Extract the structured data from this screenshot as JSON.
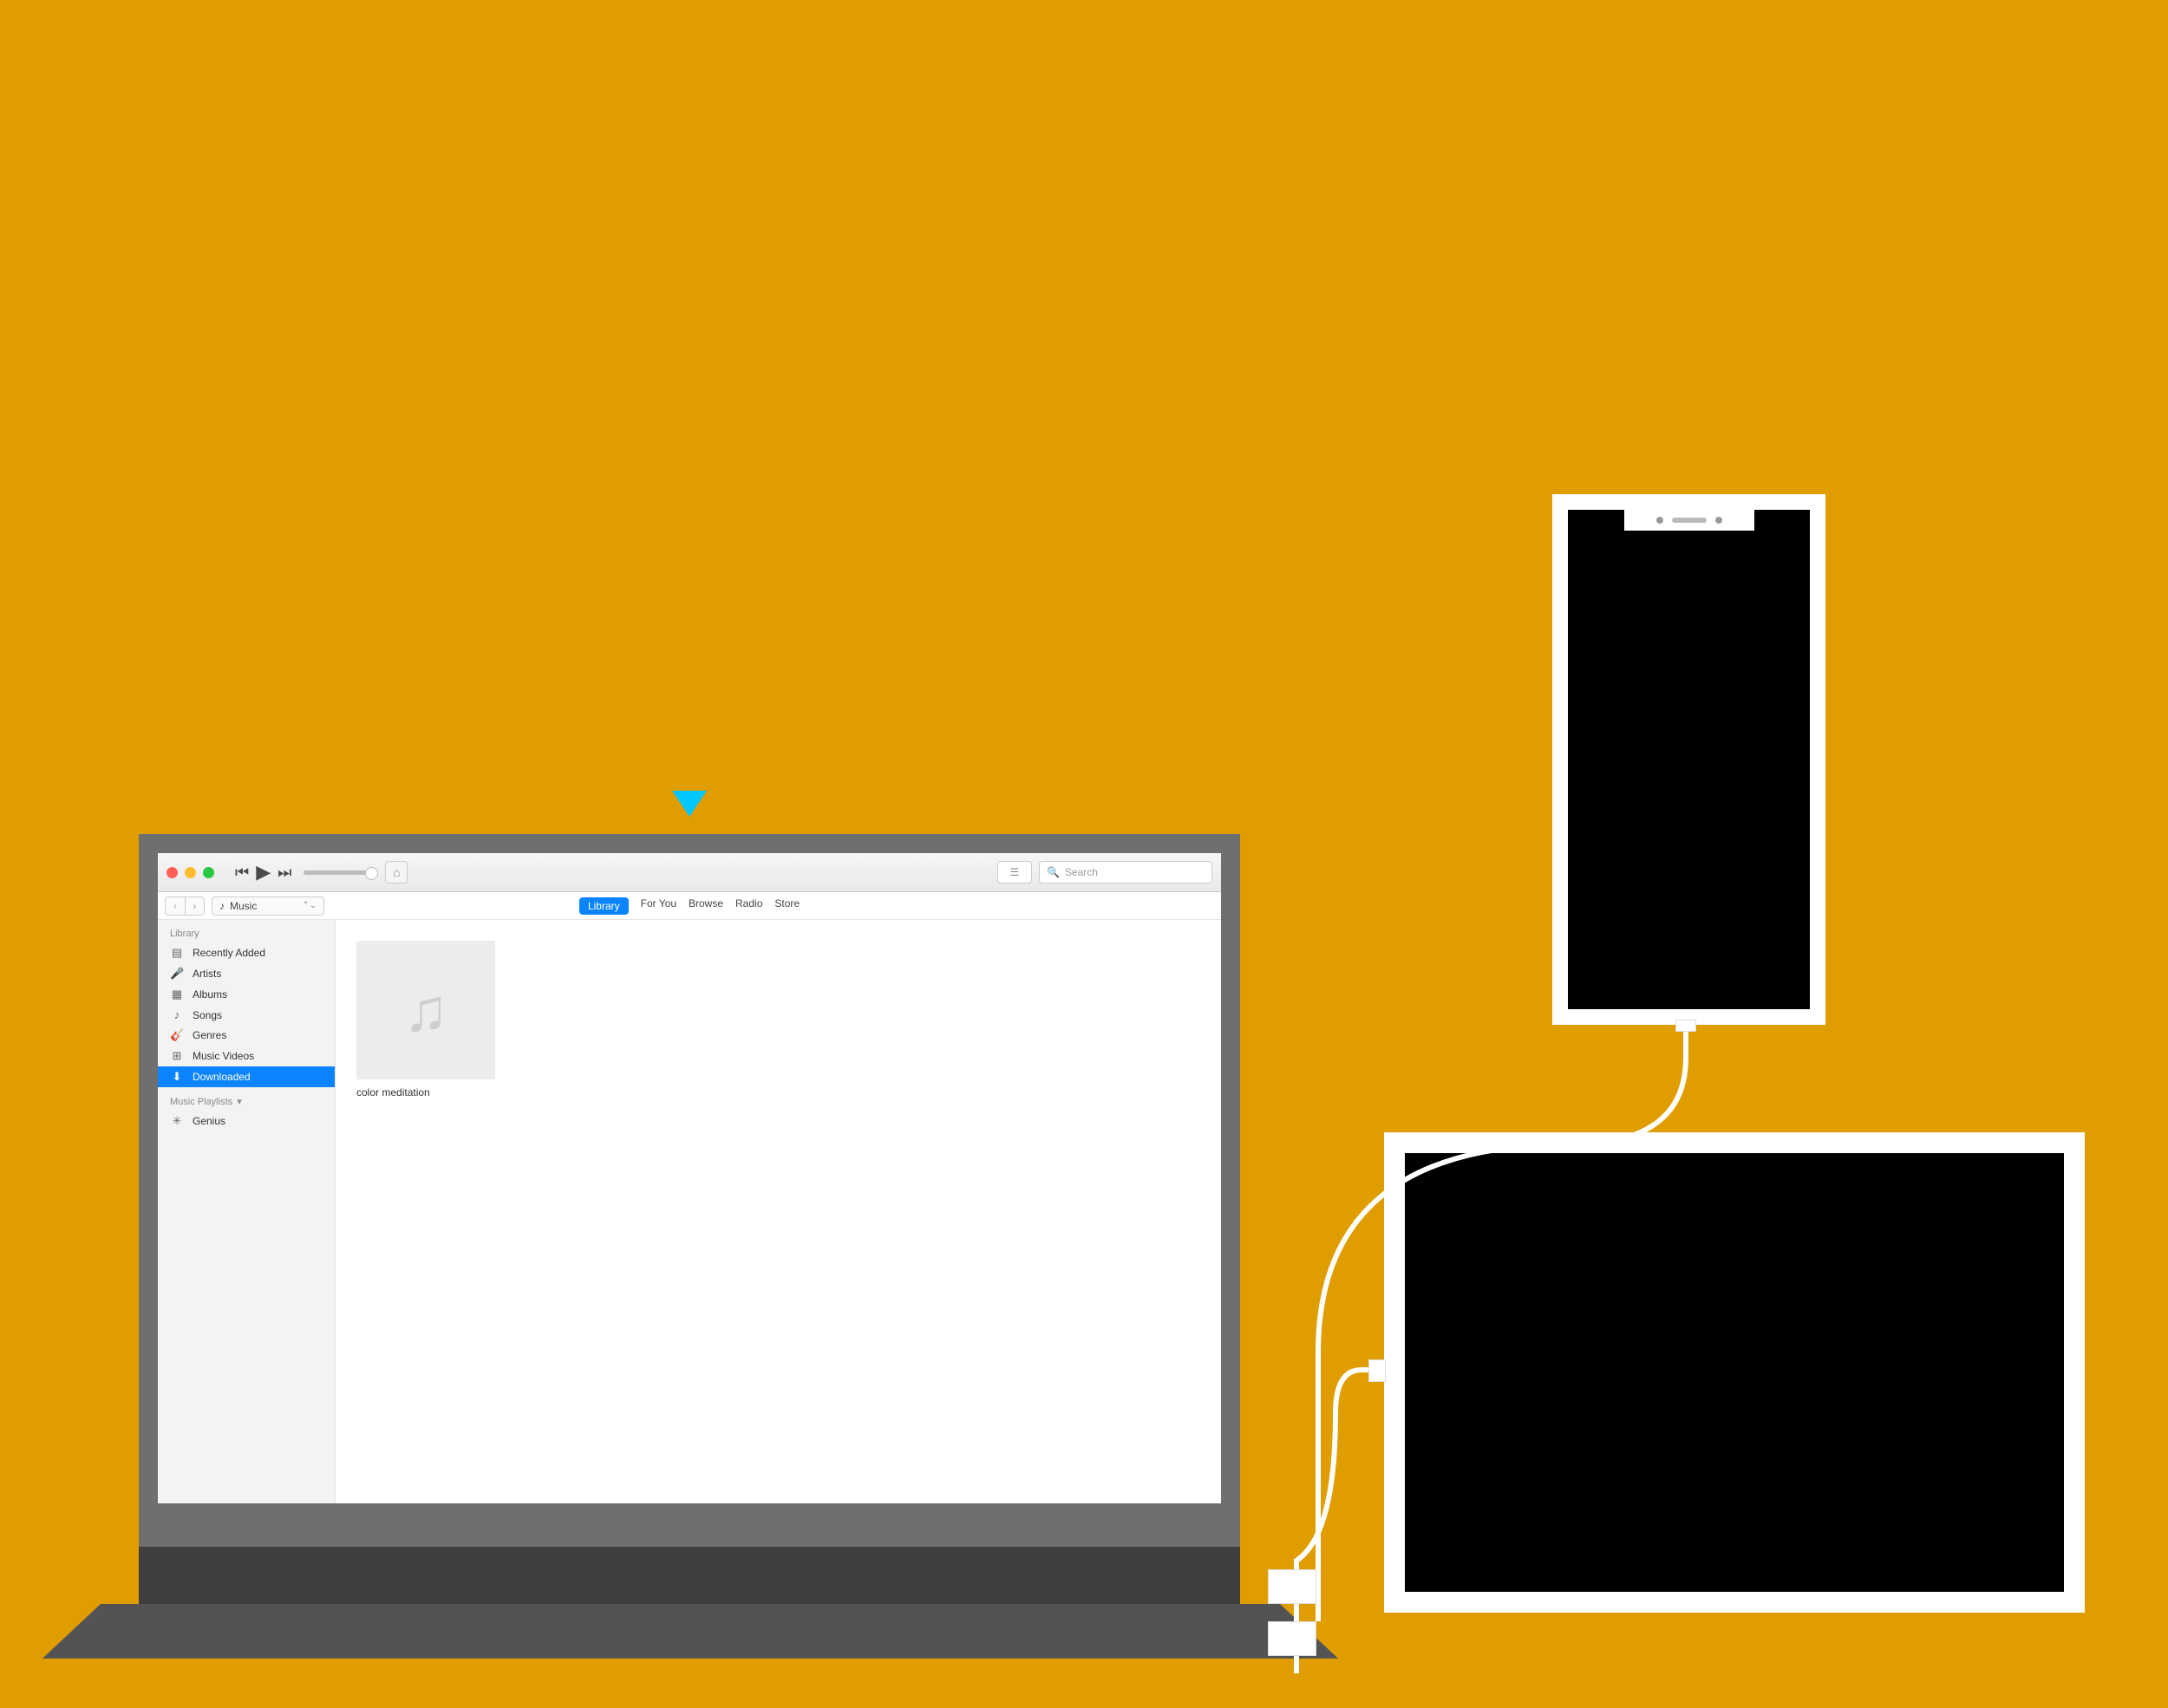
{
  "toolbar": {
    "search_placeholder": "Search",
    "source": "Music"
  },
  "tabs": {
    "items": [
      "Library",
      "For You",
      "Browse",
      "Radio",
      "Store"
    ],
    "active_index": 0
  },
  "sidebar": {
    "header": "Library",
    "items": [
      {
        "icon": "clock-icon",
        "label": "Recently Added"
      },
      {
        "icon": "mic-icon",
        "label": "Artists"
      },
      {
        "icon": "grid-icon",
        "label": "Albums"
      },
      {
        "icon": "note-icon",
        "label": "Songs"
      },
      {
        "icon": "guitar-icon",
        "label": "Genres"
      },
      {
        "icon": "video-icon",
        "label": "Music Videos"
      },
      {
        "icon": "download-icon",
        "label": "Downloaded"
      }
    ],
    "active_index": 6,
    "playlists_header": "Music Playlists",
    "playlists": [
      {
        "icon": "genius-icon",
        "label": "Genius"
      }
    ]
  },
  "content": {
    "albums": [
      {
        "title": "color meditation"
      }
    ]
  }
}
